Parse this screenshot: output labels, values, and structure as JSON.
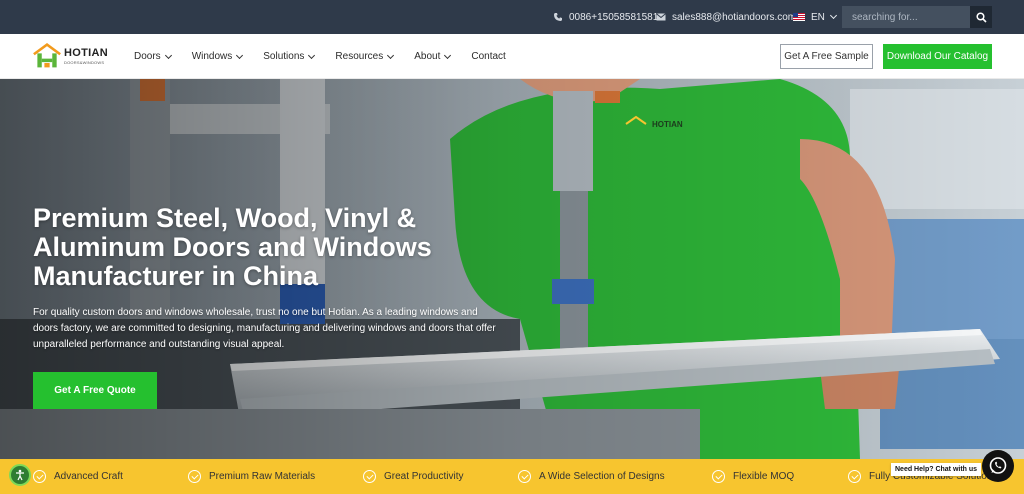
{
  "topbar": {
    "phone": "0086+15058581581",
    "email": "sales888@hotiandoors.com",
    "language": "EN",
    "search_placeholder": "searching for..."
  },
  "nav": {
    "logo_name": "HOTIAN",
    "logo_sub": "DOORS&WINDOWS",
    "menu": [
      {
        "label": "Doors",
        "has_dropdown": true
      },
      {
        "label": "Windows",
        "has_dropdown": true
      },
      {
        "label": "Solutions",
        "has_dropdown": true
      },
      {
        "label": "Resources",
        "has_dropdown": true
      },
      {
        "label": "About",
        "has_dropdown": true
      },
      {
        "label": "Contact",
        "has_dropdown": false
      }
    ],
    "sample_button": "Get A Free Sample",
    "catalog_button": "Download Our Catalog"
  },
  "hero": {
    "title": "Premium Steel, Wood, Vinyl & Aluminum Doors and Windows Manufacturer in China",
    "description": "For quality custom doors and windows wholesale, trust no one but Hotian. As a leading windows and doors factory, we are committed to designing, manufacturing and delivering windows and doors that offer unparalleled performance and outstanding visual appeal.",
    "cta_button": "Get A Free Quote",
    "shirt_logo": "HOTIAN"
  },
  "features": [
    "Advanced Craft",
    "Premium Raw Materials",
    "Great Productivity",
    "A Wide Selection of Designs",
    "Flexible MOQ",
    "Fully Customizable Solution"
  ],
  "whatsapp": {
    "label": "Need Help? Chat with us"
  },
  "colors": {
    "topbar": "#2f3a4a",
    "brand_green": "#25c02f",
    "strip_yellow": "#f7c52f"
  }
}
